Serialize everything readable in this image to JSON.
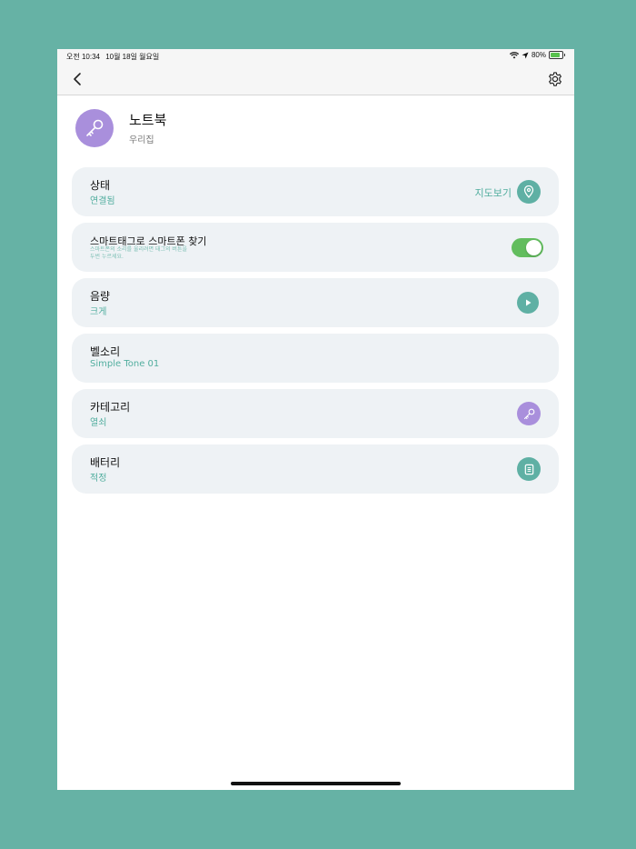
{
  "status_bar": {
    "time": "오전 10:34",
    "date": "10월 18일 월요일",
    "battery_percent": "80%",
    "battery_level": 0.8
  },
  "device": {
    "name": "노트북",
    "place": "우리집",
    "icon": "key-icon"
  },
  "cards": {
    "status": {
      "title": "상태",
      "value": "연결됨",
      "link": "지도보기",
      "icon": "map-pin-icon"
    },
    "find_phone": {
      "title": "스마트태그로 스마트폰 찾기",
      "description_line1": "스마트폰의 소리를 울리려면 태그의 버튼을",
      "description_line2": "두번 누르세요.",
      "enabled": true
    },
    "volume": {
      "title": "음량",
      "value": "크게",
      "icon": "play-icon"
    },
    "ringtone": {
      "title": "벨소리",
      "value": "Simple Tone 01"
    },
    "category": {
      "title": "카테고리",
      "value": "열쇠",
      "icon": "key-icon"
    },
    "battery": {
      "title": "배터리",
      "value": "적정",
      "icon": "document-icon"
    }
  },
  "colors": {
    "accent": "#5fb0a4",
    "purple": "#a98fdc",
    "toggle_on": "#62bd5e",
    "card_bg": "#eef2f5"
  }
}
